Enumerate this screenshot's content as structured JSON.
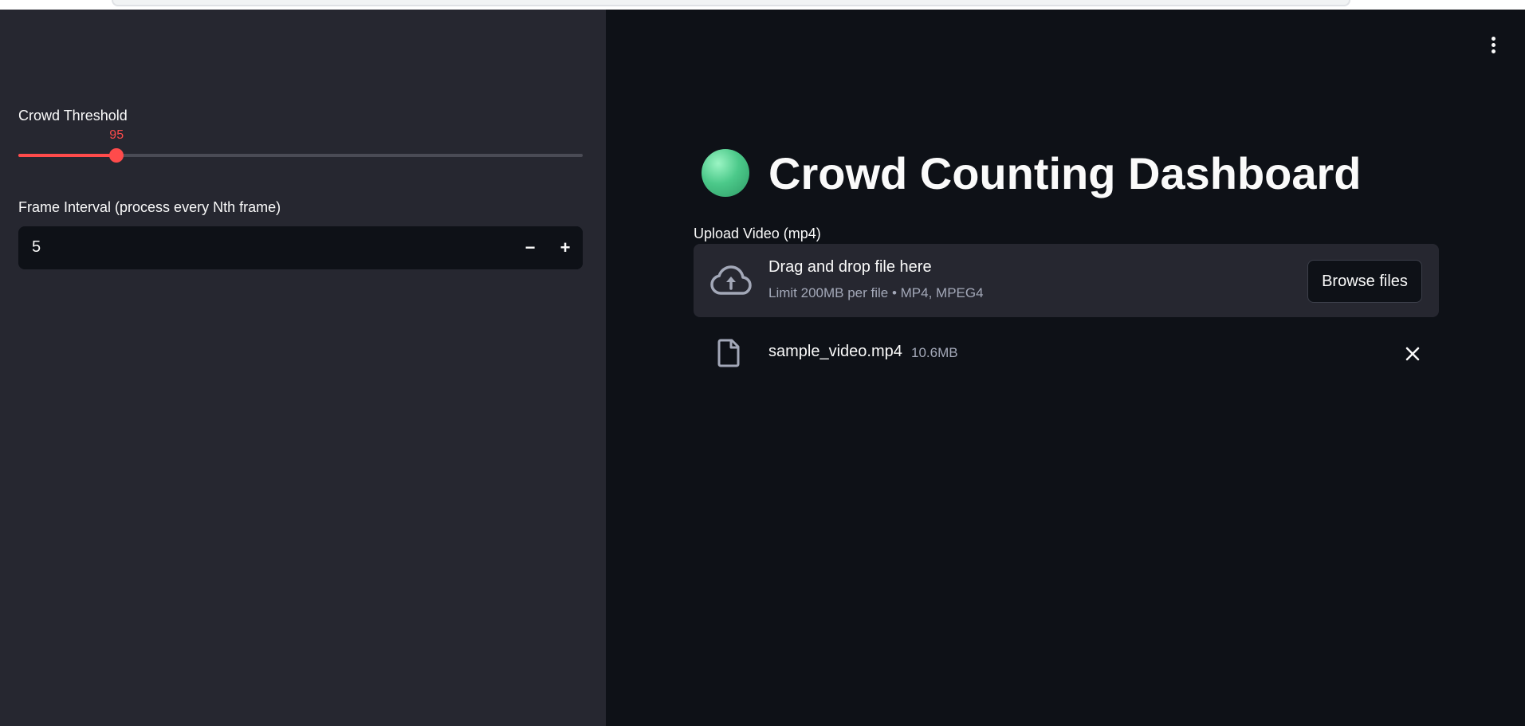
{
  "sidebar": {
    "slider": {
      "label": "Crowd Threshold",
      "value": 95,
      "value_text": "95",
      "fraction": 0.174,
      "accent_color": "#ff4b4b"
    },
    "number_input": {
      "label": "Frame Interval (process every Nth frame)",
      "value": "5",
      "minus_label": "−",
      "plus_label": "+"
    }
  },
  "main": {
    "menu_icon": "vertical-ellipsis-icon",
    "title_emoji": "green-circle-icon",
    "title": "Crowd Counting Dashboard",
    "uploader": {
      "label": "Upload Video (mp4)",
      "icon": "cloud-upload-icon",
      "drop_text": "Drag and drop file here",
      "limit_text": "Limit 200MB per file • MP4, MPEG4",
      "browse_label": "Browse files"
    },
    "uploaded_file": {
      "icon": "file-icon",
      "name": "sample_video.mp4",
      "size": "10.6MB",
      "remove_icon": "close-icon"
    }
  },
  "colors": {
    "sidebar_bg": "#262730",
    "main_bg": "#0e1117",
    "accent": "#ff4b4b",
    "text": "#fafafa",
    "muted_text": "#a3a8b8"
  }
}
